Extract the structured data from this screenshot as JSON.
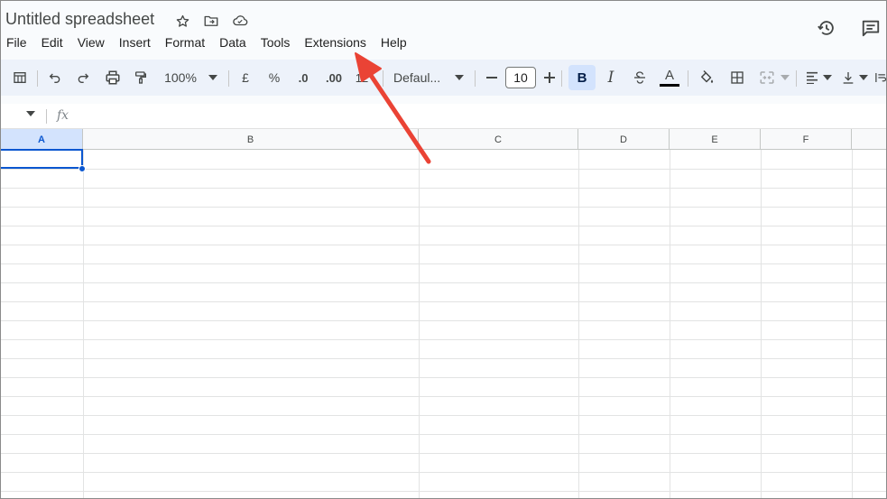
{
  "title": "Untitled spreadsheet",
  "menu": [
    "File",
    "Edit",
    "View",
    "Insert",
    "Format",
    "Data",
    "Tools",
    "Extensions",
    "Help"
  ],
  "toolbar": {
    "zoom": "100%",
    "currency": "£",
    "percent": "%",
    "decrease_decimal": ".0",
    "increase_decimal": ".00",
    "number_format": "12",
    "font": "Defaul...",
    "font_size": "10",
    "bold": "B",
    "italic": "I",
    "text_color_letter": "A"
  },
  "formula_bar": {
    "fx": "fx"
  },
  "columns": [
    "A",
    "B",
    "C",
    "D",
    "E",
    "F"
  ],
  "selected_cell": "A1",
  "colors": {
    "accent": "#0b57d0",
    "arrow": "#ea4335"
  }
}
